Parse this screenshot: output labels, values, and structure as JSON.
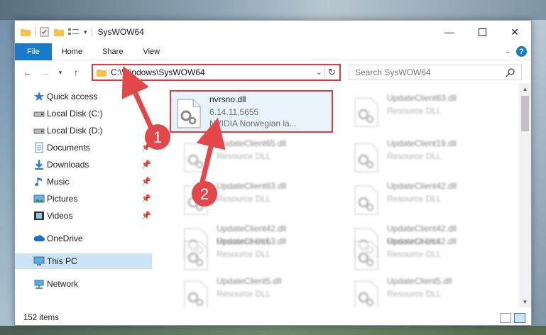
{
  "window": {
    "title": "SysWOW64"
  },
  "ribbon": {
    "tabs": [
      "File",
      "Home",
      "Share",
      "View"
    ]
  },
  "address": {
    "path": "C:\\Windows\\SysWOW64"
  },
  "search": {
    "placeholder": "Search SysWOW64"
  },
  "sidebar": {
    "items": [
      {
        "label": "Quick access",
        "icon": "star-icon"
      },
      {
        "label": "Local Disk (C:)",
        "icon": "drive-icon"
      },
      {
        "label": "Local Disk (D:)",
        "icon": "drive-icon"
      },
      {
        "label": "Documents",
        "icon": "documents-icon",
        "pinned": true
      },
      {
        "label": "Downloads",
        "icon": "downloads-icon",
        "pinned": true
      },
      {
        "label": "Music",
        "icon": "music-icon",
        "pinned": true
      },
      {
        "label": "Pictures",
        "icon": "pictures-icon",
        "pinned": true
      },
      {
        "label": "Videos",
        "icon": "videos-icon",
        "pinned": true
      },
      {
        "label": "OneDrive",
        "icon": "onedrive-icon"
      },
      {
        "label": "This PC",
        "icon": "pc-icon",
        "selected": true
      },
      {
        "label": "Network",
        "icon": "network-icon"
      }
    ]
  },
  "files": [
    {
      "name": "nvrsno.dll",
      "line2": "6.14.11.5655",
      "line3": "NVIDIA Norwegian la...",
      "highlighted": true
    },
    {
      "name": "UpdateClient63.dll",
      "line2": "Resource DLL"
    },
    {
      "name": "UpdateClient65.dll",
      "line2": "Resource DLL"
    },
    {
      "name": "UpdateClient19.dll",
      "line2": "Resource DLL"
    },
    {
      "name": "UpdateClient63.dll",
      "line2": "Resource DLL"
    },
    {
      "name": "UpdateClient42.dll",
      "line2": "Resource DLL"
    },
    {
      "name": "UpdateClient42.dll",
      "line2": "Resource DLL"
    },
    {
      "name": "UpdateClient42.dll",
      "line2": "Resource DLL"
    },
    {
      "name": "UpdateClient63.dll",
      "line2": "Resource DLL"
    },
    {
      "name": "UpdateClient42.dll",
      "line2": "Resource DLL"
    },
    {
      "name": "UpdateClient5.dll",
      "line2": "Resource DLL"
    },
    {
      "name": "UpdateClient5.dll",
      "line2": "Resource DLL"
    }
  ],
  "status": {
    "item_count": "152 items"
  },
  "annotations": {
    "step1": "1",
    "step2": "2"
  },
  "colors": {
    "accent": "#1979ca",
    "highlight_border": "#e03a3a",
    "selected_bg": "#cce4f7"
  }
}
